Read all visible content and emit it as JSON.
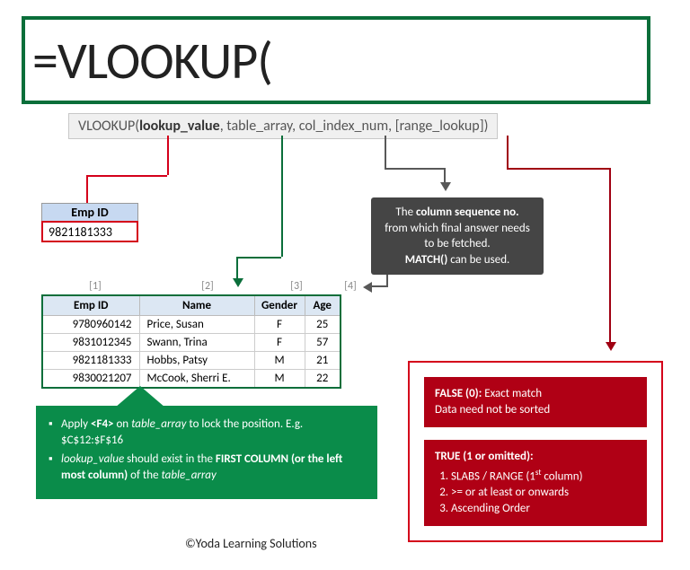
{
  "formula": "=VLOOKUP(",
  "tooltip": {
    "fn": "VLOOKUP",
    "arg1": "lookup_value",
    "arg2": "table_array",
    "arg3": "col_index_num",
    "arg4": "[range_lookup]"
  },
  "lookup_cell": {
    "header": "Emp ID",
    "value": "9821181333"
  },
  "col_numbers": [
    "[1]",
    "[2]",
    "[3]",
    "[4]"
  ],
  "table": {
    "headers": [
      "Emp ID",
      "Name",
      "Gender",
      "Age"
    ],
    "rows": [
      [
        "9780960142",
        "Price, Susan",
        "F",
        "25"
      ],
      [
        "9831012345",
        "Swann, Trina",
        "F",
        "57"
      ],
      [
        "9821181333",
        "Hobbs, Patsy",
        "M",
        "21"
      ],
      [
        "9830021207",
        "McCook, Sherri E.",
        "M",
        "22"
      ]
    ]
  },
  "green_tips": {
    "line1_pre": "Apply ",
    "line1_key": "<F4>",
    "line1_mid": " on ",
    "line1_em": "table_array",
    "line1_post": " to lock the position. E.g. $C$12:$F$16",
    "line2_em1": "lookup_value",
    "line2_mid": " should exist in the ",
    "line2_b": "FIRST COLUMN (or the left most column)",
    "line2_mid2": " of the ",
    "line2_em2": "table_array"
  },
  "gray_callout": {
    "l1_pre": "The ",
    "l1_b": "column sequence no.",
    "l2": "from which final answer needs to be fetched.",
    "l3_b": "MATCH()",
    "l3_post": " can be used."
  },
  "red_block_false": {
    "title": "FALSE (0):",
    "title_post": " Exact match",
    "line2": "Data need not be sorted"
  },
  "red_block_true": {
    "title": "TRUE (1 or omitted):",
    "li1_pre": "SLABS / RANGE (1",
    "li1_sup": "st",
    "li1_post": " column)",
    "li2": ">= or at least or onwards",
    "li3": "Ascending Order"
  },
  "copyright": "©Yoda Learning Solutions"
}
